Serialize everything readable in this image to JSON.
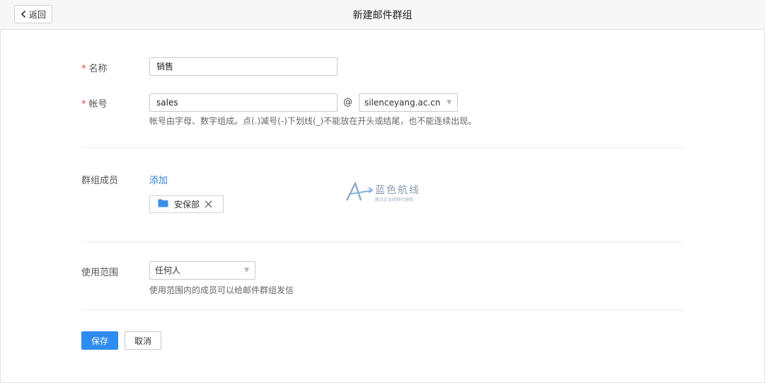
{
  "header": {
    "back_label": "返回",
    "title": "新建邮件群组"
  },
  "form": {
    "name": {
      "required_mark": "*",
      "label": "名称",
      "value": "销售"
    },
    "account": {
      "required_mark": "*",
      "label": "帐号",
      "value": "sales",
      "at_symbol": "@",
      "domain": "silenceyang.ac.cn",
      "hint": "帐号由字母、数字组成。点(.)减号(-)下划线(_)不能放在开头或结尾，也不能连续出现。"
    },
    "members": {
      "label": "群组成员",
      "add_label": "添加",
      "items": [
        {
          "name": "安保部",
          "icon": "folder-icon"
        }
      ]
    },
    "scope": {
      "label": "使用范围",
      "value": "任何人",
      "hint": "使用范围内的成员可以给邮件群组发信"
    }
  },
  "watermark": {
    "main": "蓝色航线",
    "sub": "腾讯企业邮箱代理商"
  },
  "actions": {
    "save_label": "保存",
    "cancel_label": "取消"
  },
  "colors": {
    "primary": "#2d8cf0",
    "link": "#2d7fd8",
    "required": "#e64340",
    "folder": "#3a8ee6"
  }
}
